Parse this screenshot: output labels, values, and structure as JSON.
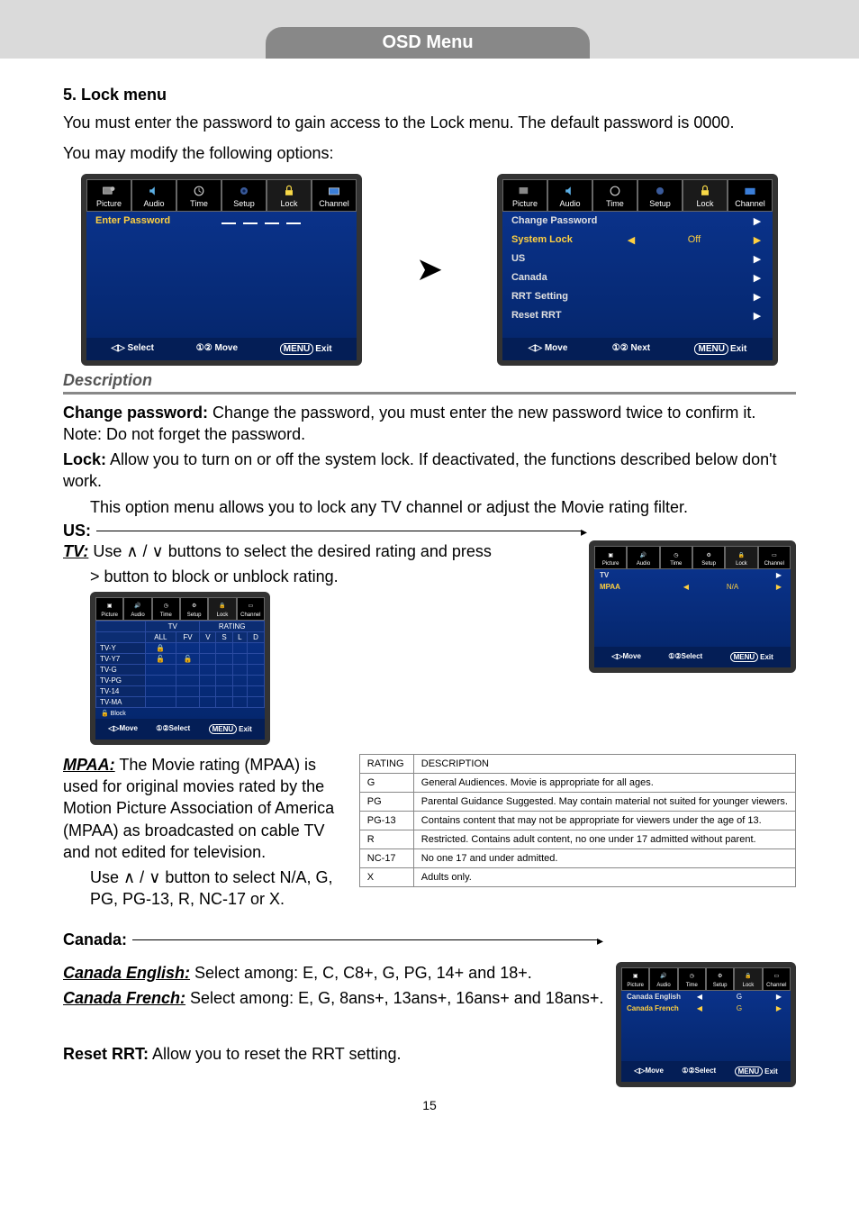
{
  "header": {
    "title": "OSD Menu"
  },
  "section": {
    "num_title": "5. Lock menu",
    "intro_1": "You must enter the password to gain access to the Lock menu. The default password is 0000.",
    "intro_2": "You may modify the following options:"
  },
  "osd_tabs": [
    "Picture",
    "Audio",
    "Time",
    "Setup",
    "Lock",
    "Channel"
  ],
  "screen_pw": {
    "row_enter": "Enter Password",
    "foot_select": "Select",
    "foot_move": "Move",
    "foot_exit": "Exit",
    "menu_label": "MENU"
  },
  "screen_lock": {
    "rows": [
      {
        "label": "Change Password",
        "val": "",
        "arrows": "r"
      },
      {
        "label": "System Lock",
        "val": "Off",
        "arrows": "lr",
        "hl": true
      },
      {
        "label": "US",
        "val": "",
        "arrows": "r"
      },
      {
        "label": "Canada",
        "val": "",
        "arrows": "r"
      },
      {
        "label": "RRT Setting",
        "val": "",
        "arrows": "r"
      },
      {
        "label": "Reset RRT",
        "val": "",
        "arrows": "r"
      }
    ],
    "foot_move": "Move",
    "foot_next": "Next",
    "foot_exit": "Exit",
    "menu_label": "MENU"
  },
  "desc": {
    "header": "Description",
    "change_pw_b": "Change password:",
    "change_pw_t": " Change the password, you must enter the new password twice to confirm it. Note: Do not forget the password.",
    "lock_b": "Lock:",
    "lock_t": " Allow you to turn on or off the system lock. If deactivated, the functions described below don't work.",
    "lock_t2": "This option menu allows you to lock any TV channel or adjust the Movie rating filter.",
    "us_b": "US:"
  },
  "tv_section": {
    "label": "TV:",
    "text_1": " Use ",
    "text_2": " buttons to select the desired rating and press",
    "text_3": "> button to block or unblock rating.",
    "updn": "∧ / ∨"
  },
  "us_screen": {
    "rows": [
      {
        "label": "TV",
        "arrows": "r"
      },
      {
        "label": "MPAA",
        "val": "N/A",
        "arrows": "lr",
        "hl": true
      }
    ],
    "foot_move": "Move",
    "foot_select": "Select",
    "foot_exit": "Exit",
    "menu_label": "MENU"
  },
  "tv_grid": {
    "top_headers": [
      "",
      "",
      "TV",
      "RATING",
      "",
      "",
      ""
    ],
    "cols": [
      "",
      "ALL",
      "FV",
      "V",
      "S",
      "L",
      "D"
    ],
    "rows": [
      {
        "label": "TV-Y",
        "cells": [
          "🔒",
          "",
          "",
          "",
          "",
          ""
        ]
      },
      {
        "label": "TV-Y7",
        "cells": [
          "🔓",
          "🔓",
          "",
          "",
          "",
          ""
        ]
      },
      {
        "label": "TV-G",
        "cells": [
          "",
          "",
          "",
          "",
          "",
          ""
        ]
      },
      {
        "label": "TV-PG",
        "cells": [
          "",
          "",
          "",
          "",
          "",
          ""
        ]
      },
      {
        "label": "TV-14",
        "cells": [
          "",
          "",
          "",
          "",
          "",
          ""
        ]
      },
      {
        "label": "TV-MA",
        "cells": [
          "",
          "",
          "",
          "",
          "",
          ""
        ]
      }
    ],
    "block_line": "🔓 Block",
    "foot_move": "Move",
    "foot_select": "Select",
    "foot_exit": "Exit",
    "menu_label": "MENU"
  },
  "mpaa": {
    "label": "MPAA:",
    "text": " The Movie rating (MPAA) is used for original movies rated by the Motion Picture Association of America (MPAA) as broadcasted on cable TV and not edited for television.",
    "text2": "Use ∧ / ∨ button to select N/A, G, PG, PG-13, R, NC-17 or X.",
    "table_header_rating": "RATING",
    "table_header_desc": "DESCRIPTION",
    "rows": [
      {
        "r": "G",
        "d": "General Audiences. Movie is appropriate for all ages."
      },
      {
        "r": "PG",
        "d": "Parental Guidance Suggested. May contain material not suited for younger viewers."
      },
      {
        "r": "PG-13",
        "d": "Contains content that may not be appropriate for viewers under the age of 13."
      },
      {
        "r": "R",
        "d": "Restricted. Contains adult content, no one under 17 admitted without parent."
      },
      {
        "r": "NC-17",
        "d": "No one 17 and under admitted."
      },
      {
        "r": "X",
        "d": "Adults only."
      }
    ]
  },
  "canada": {
    "header": "Canada:",
    "en_b": "Canada English:",
    "en_t": " Select among: E, C, C8+, G, PG, 14+ and 18+.",
    "fr_b": "Canada French:",
    "fr_t": " Select among: E, G, 8ans+, 13ans+, 16ans+ and 18ans+."
  },
  "canada_screen": {
    "rows": [
      {
        "label": "Canada English",
        "val": "G",
        "arrows": "lr",
        "hl": false
      },
      {
        "label": "Canada French",
        "val": "G",
        "arrows": "lr",
        "hl": true
      }
    ],
    "foot_move": "Move",
    "foot_select": "Select",
    "foot_exit": "Exit",
    "menu_label": "MENU"
  },
  "reset_rrt": {
    "b": "Reset RRT:",
    "t": " Allow you to reset the RRT setting."
  },
  "page_number": "15"
}
